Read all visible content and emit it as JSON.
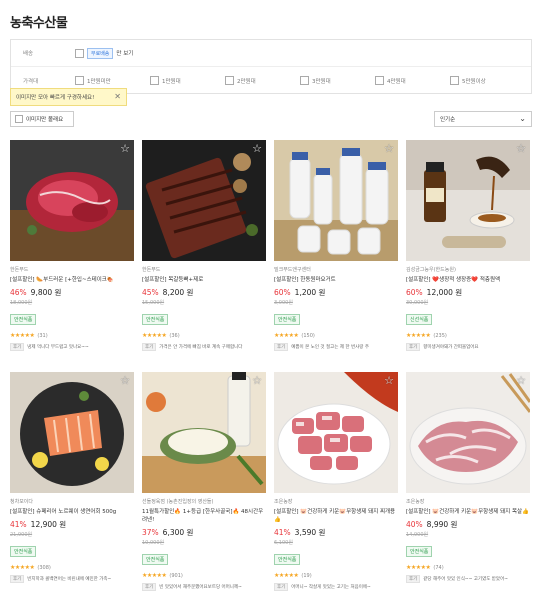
{
  "page_title": "농축수산물",
  "filters": {
    "delivery_label": "배송",
    "free_badge": "무료배송",
    "free_only_text": "만 보기",
    "price_label": "가격대",
    "price_options": [
      "1만원미만",
      "1만원대",
      "2만원대",
      "3만원대",
      "4만원대",
      "5만원이상"
    ]
  },
  "tooltip": {
    "text": "이미지만 모아 빠르게 구경하세요!",
    "close": "✕"
  },
  "image_only_toggle": "이미지만 볼래요",
  "sort": {
    "selected": "인기순",
    "chevron": "⌄"
  },
  "favorite_icon": "☆",
  "products": [
    {
      "vendor": "한돈푸드",
      "name": "[설프할인] 🌭부드러운 [+한입~스테이크🍖",
      "discount": "46%",
      "price": "9,800 원",
      "original": "18,000원",
      "badge": "안전식품",
      "stars": "★★★★★",
      "rating_count": "(31)",
      "review_tag": "후기",
      "review": "냉제 먹니다 부드럽고 맛나요~~"
    },
    {
      "vendor": "한돈푸드",
      "name": "[설프할인] 목갈등뼈+제로",
      "discount": "45%",
      "price": "8,200 원",
      "original": "15,000원",
      "badge": "안전식품",
      "stars": "★★★★★",
      "rating_count": "(36)",
      "review_tag": "후기",
      "review": "가격은 안 가격에 빠짐 바로 계속 구매합니다"
    },
    {
      "vendor": "밀크푸드앤구센터",
      "name": "[설프할인] 한동원마요거트",
      "discount": "60%",
      "price": "1,200 원",
      "original": "3,000원",
      "badge": "안전식품",
      "stars": "★★★★★",
      "rating_count": "(150)",
      "review_tag": "후기",
      "review": "예쁨이 본 노인 것 절고는 제 한 번사랑 주"
    },
    {
      "vendor": "김성금그능우(한드농원)",
      "name": "[설프할인] ❤️생장적 생장증❤️ 적층원액",
      "discount": "60%",
      "price": "12,000 원",
      "original": "30,000원",
      "badge": "신선식품",
      "stars": "★★★★★",
      "rating_count": "(235)",
      "review_tag": "후기",
      "review": "향미생겨야돼가 간떠올업어요"
    },
    {
      "vendor": "청차모이다",
      "name": "[설프할인] 슈페리어 노르웨이 생연어회 500g",
      "discount": "41%",
      "price": "12,900 원",
      "original": "21,900원",
      "badge": "안전식품",
      "stars": "★★★★★",
      "rating_count": "(308)",
      "review_tag": "후기",
      "review": "빈지학과 콜백연어는 비린내에 예민한 가족~"
    },
    {
      "vendor": "선돌정육점 (농촌진입장의 영산들)",
      "name": "11월특가할인🔥 1+등급 [한우사골국]🔥 48시간우려낸!",
      "discount": "37%",
      "price": "6,300 원",
      "original": "10,000원",
      "badge": "안전식품",
      "stars": "★★★★★",
      "rating_count": "(901)",
      "review_tag": "후기",
      "review": "빈 맛있어서 재주문했어요보트당 어머니께~"
    },
    {
      "vendor": "조은농장",
      "name": "[설프할인] 🐷건강하게 키운🐷무항생제 돼지 찌개용👍",
      "discount": "41%",
      "price": "3,590 원",
      "original": "6,100원",
      "badge": "안전식품",
      "stars": "★★★★★",
      "rating_count": "(19)",
      "review_tag": "후기",
      "review": "어머니~ 작살게 맛있는 고기는 처음이에~"
    },
    {
      "vendor": "조은농장",
      "name": "[설프할인] 🐷건강하게 키운🐷무항생제 돼지 목살👍",
      "discount": "40%",
      "price": "8,990 원",
      "original": "14,900원",
      "badge": "안전식품",
      "stars": "★★★★★",
      "rating_count": "(74)",
      "review_tag": "후기",
      "review": "같당 해주어 맛있 인식~~ 고기였도 받았어~"
    }
  ]
}
